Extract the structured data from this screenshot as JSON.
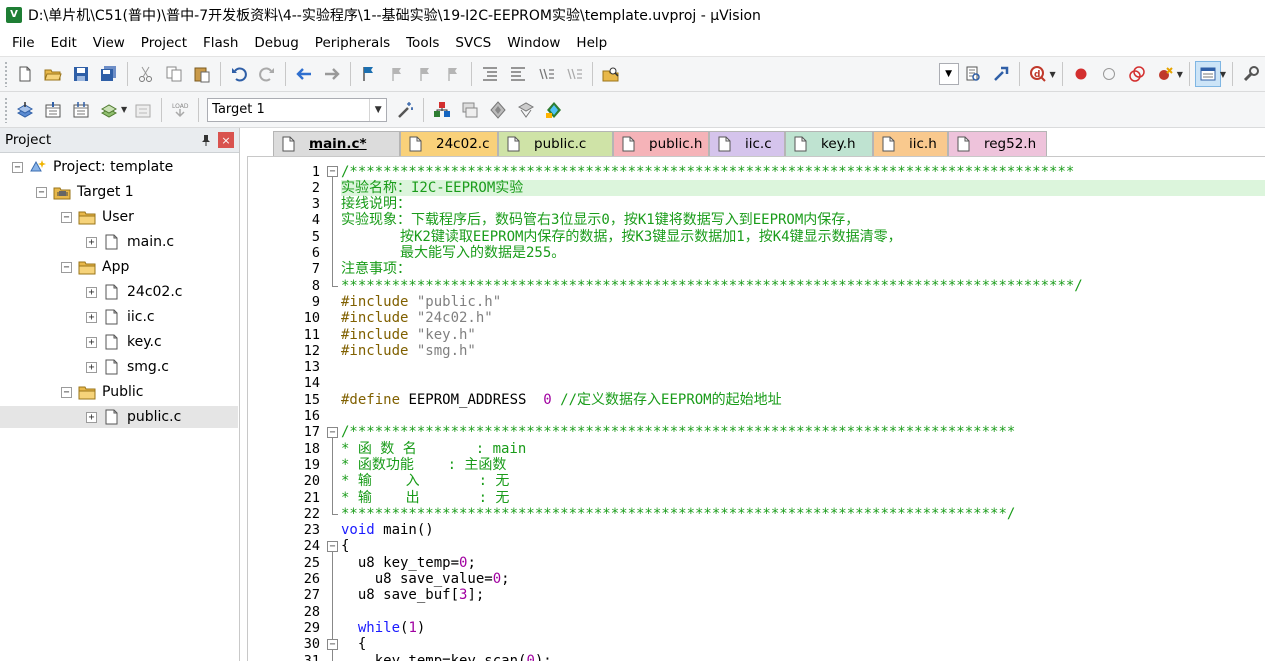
{
  "window": {
    "title": "D:\\单片机\\C51(普中)\\普中-7开发板资料\\4--实验程序\\1--基础实验\\19-I2C-EEPROM实验\\template.uvproj - µVision",
    "logo_text": "V"
  },
  "menu": [
    "File",
    "Edit",
    "View",
    "Project",
    "Flash",
    "Debug",
    "Peripherals",
    "Tools",
    "SVCS",
    "Window",
    "Help"
  ],
  "toolbar2": {
    "target_value": "Target 1"
  },
  "project_panel": {
    "title": "Project",
    "pin_glyph": "📌",
    "close_glyph": "×",
    "tree": [
      {
        "label": "Project: template",
        "level": 0,
        "type": "project",
        "expander": "−"
      },
      {
        "label": "Target 1",
        "level": 1,
        "type": "target",
        "expander": "−"
      },
      {
        "label": "User",
        "level": 2,
        "type": "folder",
        "expander": "−"
      },
      {
        "label": "main.c",
        "level": 3,
        "type": "file",
        "expander": "+"
      },
      {
        "label": "App",
        "level": 2,
        "type": "folder",
        "expander": "−"
      },
      {
        "label": "24c02.c",
        "level": 3,
        "type": "file",
        "expander": "+"
      },
      {
        "label": "iic.c",
        "level": 3,
        "type": "file",
        "expander": "+"
      },
      {
        "label": "key.c",
        "level": 3,
        "type": "file",
        "expander": "+"
      },
      {
        "label": "smg.c",
        "level": 3,
        "type": "file",
        "expander": "+"
      },
      {
        "label": "Public",
        "level": 2,
        "type": "folder",
        "expander": "−"
      },
      {
        "label": "public.c",
        "level": 3,
        "type": "file",
        "expander": "+",
        "selected": true
      }
    ]
  },
  "tabs": [
    {
      "label": "main.c*",
      "color": "#dcdcdc",
      "active": true
    },
    {
      "label": "24c02.c",
      "color": "#f9d17a"
    },
    {
      "label": "public.c",
      "color": "#cfe3a7"
    },
    {
      "label": "public.h",
      "color": "#f5b3b8"
    },
    {
      "label": "iic.c",
      "color": "#d5c4ec"
    },
    {
      "label": "key.h",
      "color": "#bfe3d1"
    },
    {
      "label": "iic.h",
      "color": "#f9c98e"
    },
    {
      "label": "reg52.h",
      "color": "#eec3db"
    }
  ],
  "code": {
    "highlight_line": 2,
    "lines": [
      {
        "n": "1",
        "segs": [
          {
            "c": "cm",
            "t": "/**************************************************************************************"
          }
        ]
      },
      {
        "n": "2",
        "segs": [
          {
            "c": "cm",
            "t": "实验名称：I2C-EEPROM实验"
          }
        ]
      },
      {
        "n": "3",
        "segs": [
          {
            "c": "cm",
            "t": "接线说明："
          }
        ]
      },
      {
        "n": "4",
        "segs": [
          {
            "c": "cm",
            "t": "实验现象：下载程序后，数码管右3位显示0，按K1键将数据写入到EEPROM内保存，"
          }
        ]
      },
      {
        "n": "5",
        "segs": [
          {
            "c": "cm",
            "t": "       按K2键读取EEPROM内保存的数据，按K3键显示数据加1，按K4键显示数据清零，"
          }
        ]
      },
      {
        "n": "6",
        "segs": [
          {
            "c": "cm",
            "t": "       最大能写入的数据是255。"
          }
        ]
      },
      {
        "n": "7",
        "segs": [
          {
            "c": "cm",
            "t": "注意事项："
          }
        ]
      },
      {
        "n": "8",
        "segs": [
          {
            "c": "cm",
            "t": "***************************************************************************************/"
          }
        ]
      },
      {
        "n": "9",
        "segs": [
          {
            "c": "pp",
            "t": "#include "
          },
          {
            "c": "str",
            "t": "\"public.h\""
          }
        ]
      },
      {
        "n": "10",
        "segs": [
          {
            "c": "pp",
            "t": "#include "
          },
          {
            "c": "str",
            "t": "\"24c02.h\""
          }
        ]
      },
      {
        "n": "11",
        "segs": [
          {
            "c": "pp",
            "t": "#include "
          },
          {
            "c": "str",
            "t": "\"key.h\""
          }
        ]
      },
      {
        "n": "12",
        "segs": [
          {
            "c": "pp",
            "t": "#include "
          },
          {
            "c": "str",
            "t": "\"smg.h\""
          }
        ]
      },
      {
        "n": "13",
        "segs": []
      },
      {
        "n": "14",
        "segs": []
      },
      {
        "n": "15",
        "segs": [
          {
            "c": "pp",
            "t": "#define "
          },
          {
            "c": "",
            "t": "EEPROM_ADDRESS  "
          },
          {
            "c": "num",
            "t": "0"
          },
          {
            "c": "",
            "t": " "
          },
          {
            "c": "cm",
            "t": "//定义数据存入EEPROM的起始地址"
          }
        ]
      },
      {
        "n": "16",
        "segs": []
      },
      {
        "n": "17",
        "segs": [
          {
            "c": "cm",
            "t": "/*******************************************************************************"
          }
        ]
      },
      {
        "n": "18",
        "segs": [
          {
            "c": "cm",
            "t": "* 函 数 名       : main"
          }
        ]
      },
      {
        "n": "19",
        "segs": [
          {
            "c": "cm",
            "t": "* 函数功能    : 主函数"
          }
        ]
      },
      {
        "n": "20",
        "segs": [
          {
            "c": "cm",
            "t": "* 输    入       : 无"
          }
        ]
      },
      {
        "n": "21",
        "segs": [
          {
            "c": "cm",
            "t": "* 输    出       : 无"
          }
        ]
      },
      {
        "n": "22",
        "segs": [
          {
            "c": "cm",
            "t": "*******************************************************************************/"
          }
        ]
      },
      {
        "n": "23",
        "segs": [
          {
            "c": "kw",
            "t": "void"
          },
          {
            "c": "",
            "t": " main()"
          }
        ]
      },
      {
        "n": "24",
        "segs": [
          {
            "c": "",
            "t": "{"
          }
        ]
      },
      {
        "n": "25",
        "segs": [
          {
            "c": "",
            "t": "  u8 key_temp="
          },
          {
            "c": "num",
            "t": "0"
          },
          {
            "c": "",
            "t": ";"
          }
        ]
      },
      {
        "n": "26",
        "segs": [
          {
            "c": "",
            "t": "    u8 save_value="
          },
          {
            "c": "num",
            "t": "0"
          },
          {
            "c": "",
            "t": ";"
          }
        ]
      },
      {
        "n": "27",
        "segs": [
          {
            "c": "",
            "t": "  u8 save_buf["
          },
          {
            "c": "num",
            "t": "3"
          },
          {
            "c": "",
            "t": "];"
          }
        ]
      },
      {
        "n": "28",
        "segs": []
      },
      {
        "n": "29",
        "segs": [
          {
            "c": "",
            "t": "  "
          },
          {
            "c": "kw",
            "t": "while"
          },
          {
            "c": "",
            "t": "("
          },
          {
            "c": "num",
            "t": "1"
          },
          {
            "c": "",
            "t": ")"
          }
        ]
      },
      {
        "n": "30",
        "segs": [
          {
            "c": "",
            "t": "  {"
          }
        ]
      },
      {
        "n": "31",
        "segs": [
          {
            "c": "",
            "t": "    key_temp=key_scan("
          },
          {
            "c": "num",
            "t": "0"
          },
          {
            "c": "",
            "t": ");"
          }
        ]
      }
    ]
  },
  "folds": [
    {
      "line": 1,
      "glyph": "−",
      "end": 8
    },
    {
      "line": 17,
      "glyph": "−",
      "end": 22
    },
    {
      "line": 24,
      "glyph": "−",
      "end": 31
    },
    {
      "line": 30,
      "glyph": "−",
      "end": 31
    }
  ]
}
